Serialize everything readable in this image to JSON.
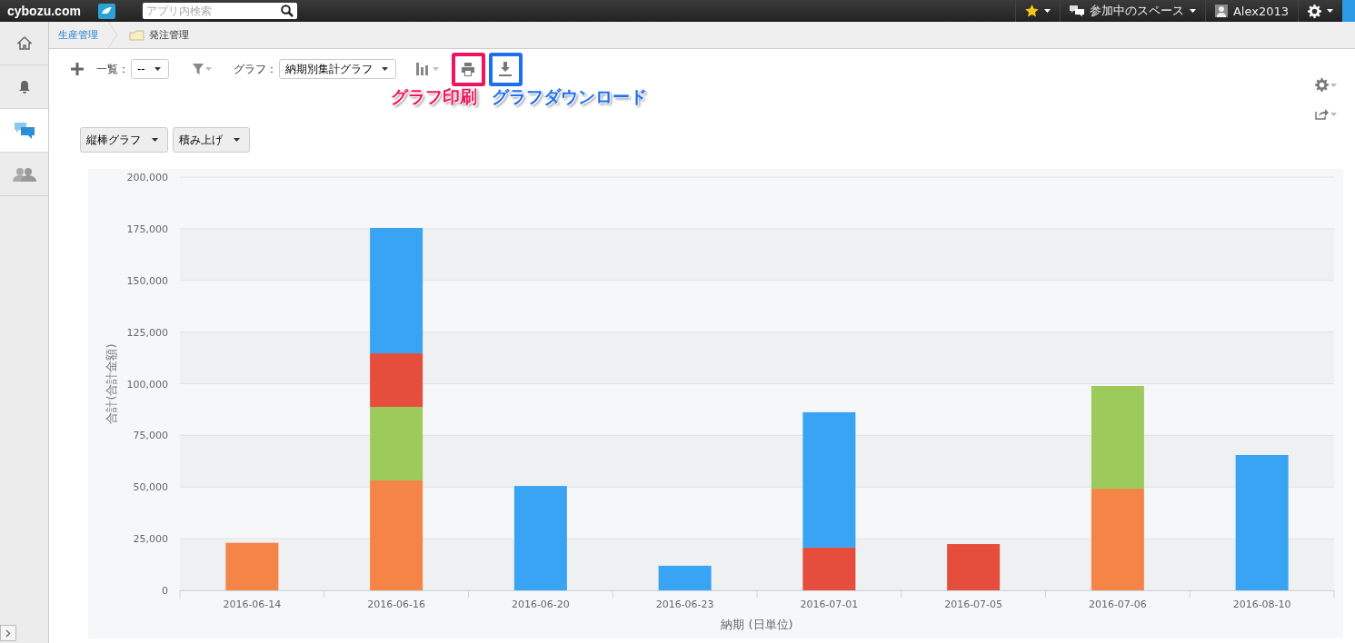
{
  "topbar": {
    "logo": "cybozu.com",
    "search": {
      "placeholder": "アプリ内検索"
    },
    "spaces_label": "参加中のスペース",
    "user": "Alex2013"
  },
  "sidebar": {
    "items": [
      {
        "kind": "home",
        "selected": false
      },
      {
        "kind": "bell",
        "selected": false
      },
      {
        "kind": "chat",
        "selected": true
      },
      {
        "kind": "people",
        "selected": false
      }
    ]
  },
  "breadcrumb": [
    {
      "label": "生産管理",
      "kind": "link"
    },
    {
      "label": "発注管理",
      "kind": "current"
    }
  ],
  "toolbar": {
    "list_label": "一覧：",
    "list_value": "--",
    "graph_label": "グラフ：",
    "graph_value": "納期別集計グラフ",
    "actions": [
      {
        "kind": "print",
        "color": "#f0145c"
      },
      {
        "kind": "download",
        "color": "#1e6ff0"
      }
    ]
  },
  "annotations": [
    {
      "text": "グラフ印刷",
      "color": "#f0145c"
    },
    {
      "text": "グラフダウンロード",
      "color": "#1e6ff0"
    }
  ],
  "chart_options": [
    "縦棒グラフ",
    "積み上げ"
  ],
  "chart": {
    "chart_data": {
      "type": "bar",
      "stacked": true,
      "grid": true,
      "xlabel": "納期 (日単位)",
      "ylabel": "合計(合計金額)",
      "categories": [
        "2016-06-14",
        "2016-06-16",
        "2016-06-20",
        "2016-06-23",
        "2016-07-01",
        "2016-07-05",
        "2016-07-06",
        "2016-08-10"
      ],
      "ylim": [
        0,
        200000
      ],
      "yticks": [
        {
          "value": 0,
          "label": "0"
        },
        {
          "value": 25000,
          "label": "25,000"
        },
        {
          "value": 50000,
          "label": "50,000"
        },
        {
          "value": 75000,
          "label": "75,000"
        },
        {
          "value": 100000,
          "label": "100,000"
        },
        {
          "value": 125000,
          "label": "125,000"
        },
        {
          "value": 150000,
          "label": "150,000"
        },
        {
          "value": 175000,
          "label": "175,000"
        },
        {
          "value": 200000,
          "label": "200,000"
        }
      ],
      "series": [
        {
          "color": "#f58447",
          "values": [
            23000,
            53200,
            null,
            null,
            null,
            null,
            49200,
            null
          ]
        },
        {
          "color": "#9ccb5b",
          "values": [
            null,
            35600,
            null,
            null,
            null,
            null,
            49700,
            null
          ]
        },
        {
          "color": "#e54d3c",
          "values": [
            null,
            25900,
            null,
            null,
            20700,
            22400,
            null,
            null
          ]
        },
        {
          "color": "#38a4f3",
          "values": [
            null,
            60700,
            50500,
            11900,
            65500,
            null,
            null,
            65500
          ]
        }
      ]
    }
  }
}
